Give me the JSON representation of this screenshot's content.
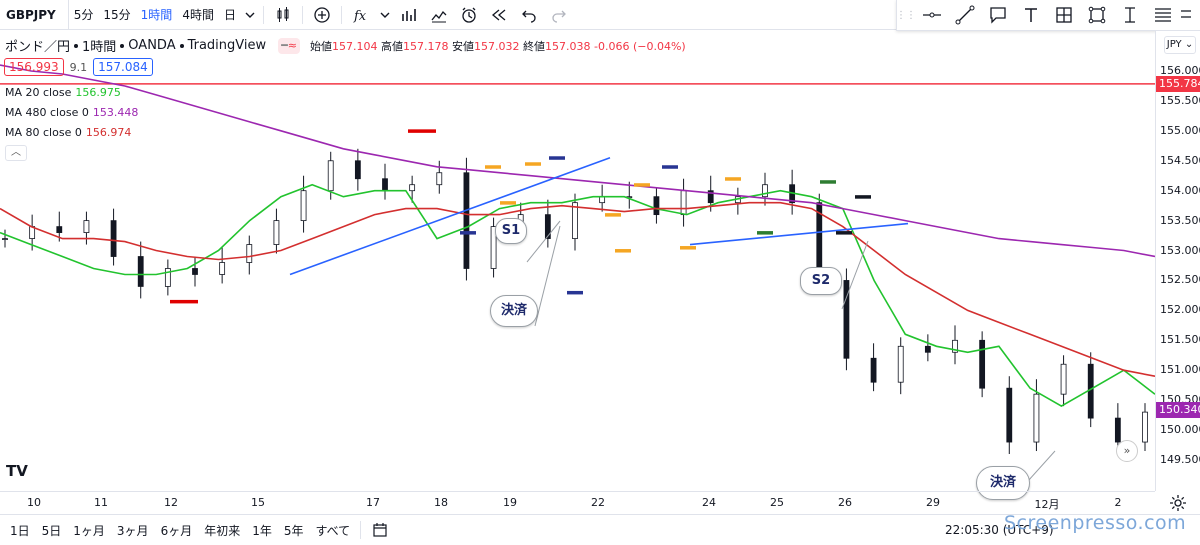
{
  "topbar": {
    "symbol": "GBPJPY",
    "intervals": [
      {
        "label": "5分",
        "active": false
      },
      {
        "label": "15分",
        "active": false
      },
      {
        "label": "1時間",
        "active": true
      },
      {
        "label": "4時間",
        "active": false
      },
      {
        "label": "日",
        "active": false
      }
    ]
  },
  "legend": {
    "name": "ポンド／円",
    "interval": "1時間",
    "broker": "OANDA",
    "source": "TradingView",
    "open_label": "始値",
    "open": "157.104",
    "high_label": "高値",
    "high": "157.178",
    "low_label": "安値",
    "low": "157.032",
    "close_label": "終値",
    "close": "157.038",
    "change": "-0.066 (−0.04%)"
  },
  "quote": {
    "bid": "156.993",
    "spread": "9.1",
    "ask": "157.084"
  },
  "indicators": [
    {
      "label": "MA 20 close",
      "value": "156.975",
      "color": "#22c32e"
    },
    {
      "label": "MA 480 close 0",
      "value": "153.448",
      "color": "#9c27b0"
    },
    {
      "label": "MA 80 close 0",
      "value": "156.974",
      "color": "#d32f2f"
    }
  ],
  "price_axis": {
    "currency": "JPY",
    "ticks": [
      "156.000",
      "155.500",
      "155.000",
      "154.500",
      "154.000",
      "153.500",
      "153.000",
      "152.500",
      "152.000",
      "151.500",
      "151.000",
      "150.500",
      "150.000",
      "149.500"
    ],
    "tags": [
      {
        "value": "155.784",
        "color": "#f23645"
      },
      {
        "value": "150.340",
        "color": "#9c27b0"
      }
    ]
  },
  "time_axis": [
    "10",
    "11",
    "12",
    "15",
    "17",
    "18",
    "19",
    "22",
    "24",
    "25",
    "26",
    "29",
    "12月",
    "2"
  ],
  "annotations": {
    "s1": "S1",
    "s2": "S2",
    "settle1": "決済",
    "settle2": "決済"
  },
  "bottombar": {
    "ranges": [
      "1日",
      "5日",
      "1ヶ月",
      "3ヶ月",
      "6ヶ月",
      "年初来",
      "1年",
      "5年",
      "すべて"
    ],
    "clock": "22:05:30 (UTC+9)",
    "watermark": "Screenpresso.com"
  },
  "chart_data": {
    "type": "line",
    "ylim": [
      149.2,
      156.3
    ],
    "horizontal_line": 155.784,
    "x_labels": [
      "10",
      "11",
      "12",
      "15",
      "17",
      "18",
      "19",
      "22",
      "24",
      "25",
      "26",
      "29",
      "12月",
      "2"
    ],
    "series": [
      {
        "name": "MA 20 close",
        "color": "#22c32e",
        "values": [
          153.3,
          153.1,
          152.9,
          152.7,
          152.6,
          152.6,
          152.7,
          153.0,
          153.5,
          153.9,
          154.1,
          153.9,
          154.0,
          154.0,
          153.2,
          153.4,
          153.7,
          153.8,
          153.8,
          153.9,
          153.9,
          153.7,
          153.6,
          153.8,
          153.9,
          154.0,
          153.9,
          153.7,
          152.5,
          151.6,
          151.4,
          151.3,
          151.4,
          150.7,
          150.4,
          150.7,
          151.0,
          150.6
        ]
      },
      {
        "name": "MA 480 close 0",
        "color": "#9c27b0",
        "values": [
          156.1,
          156.0,
          155.95,
          155.85,
          155.75,
          155.6,
          155.45,
          155.3,
          155.15,
          155.0,
          154.85,
          154.7,
          154.6,
          154.5,
          154.4,
          154.35,
          154.3,
          154.25,
          154.2,
          154.15,
          154.1,
          154.05,
          154.0,
          153.95,
          153.9,
          153.85,
          153.8,
          153.7,
          153.6,
          153.5,
          153.4,
          153.3,
          153.2,
          153.15,
          153.1,
          153.05,
          153.0,
          152.9
        ]
      },
      {
        "name": "MA 80 close 0",
        "color": "#d32f2f",
        "values": [
          153.7,
          153.4,
          153.2,
          153.2,
          153.15,
          153.0,
          152.9,
          152.85,
          152.9,
          153.0,
          153.2,
          153.4,
          153.6,
          153.7,
          153.7,
          153.6,
          153.6,
          153.7,
          153.75,
          153.7,
          153.65,
          153.7,
          153.7,
          153.75,
          153.8,
          153.8,
          153.7,
          153.4,
          153.0,
          152.6,
          152.3,
          152.0,
          151.8,
          151.6,
          151.4,
          151.2,
          151.0,
          150.9
        ]
      },
      {
        "name": "close",
        "color": "#131722",
        "values": [
          153.2,
          153.4,
          153.3,
          153.5,
          152.9,
          152.4,
          152.7,
          152.6,
          152.8,
          153.1,
          153.5,
          154.0,
          154.5,
          154.2,
          154.0,
          154.1,
          154.3,
          152.7,
          153.4,
          153.6,
          153.2,
          153.8,
          153.9,
          153.9,
          153.6,
          154.0,
          153.8,
          153.9,
          154.1,
          153.8,
          152.5,
          151.2,
          150.8,
          151.4,
          151.3,
          151.5,
          150.7,
          149.8,
          150.6,
          151.1,
          150.2,
          149.8,
          150.3
        ]
      }
    ]
  }
}
